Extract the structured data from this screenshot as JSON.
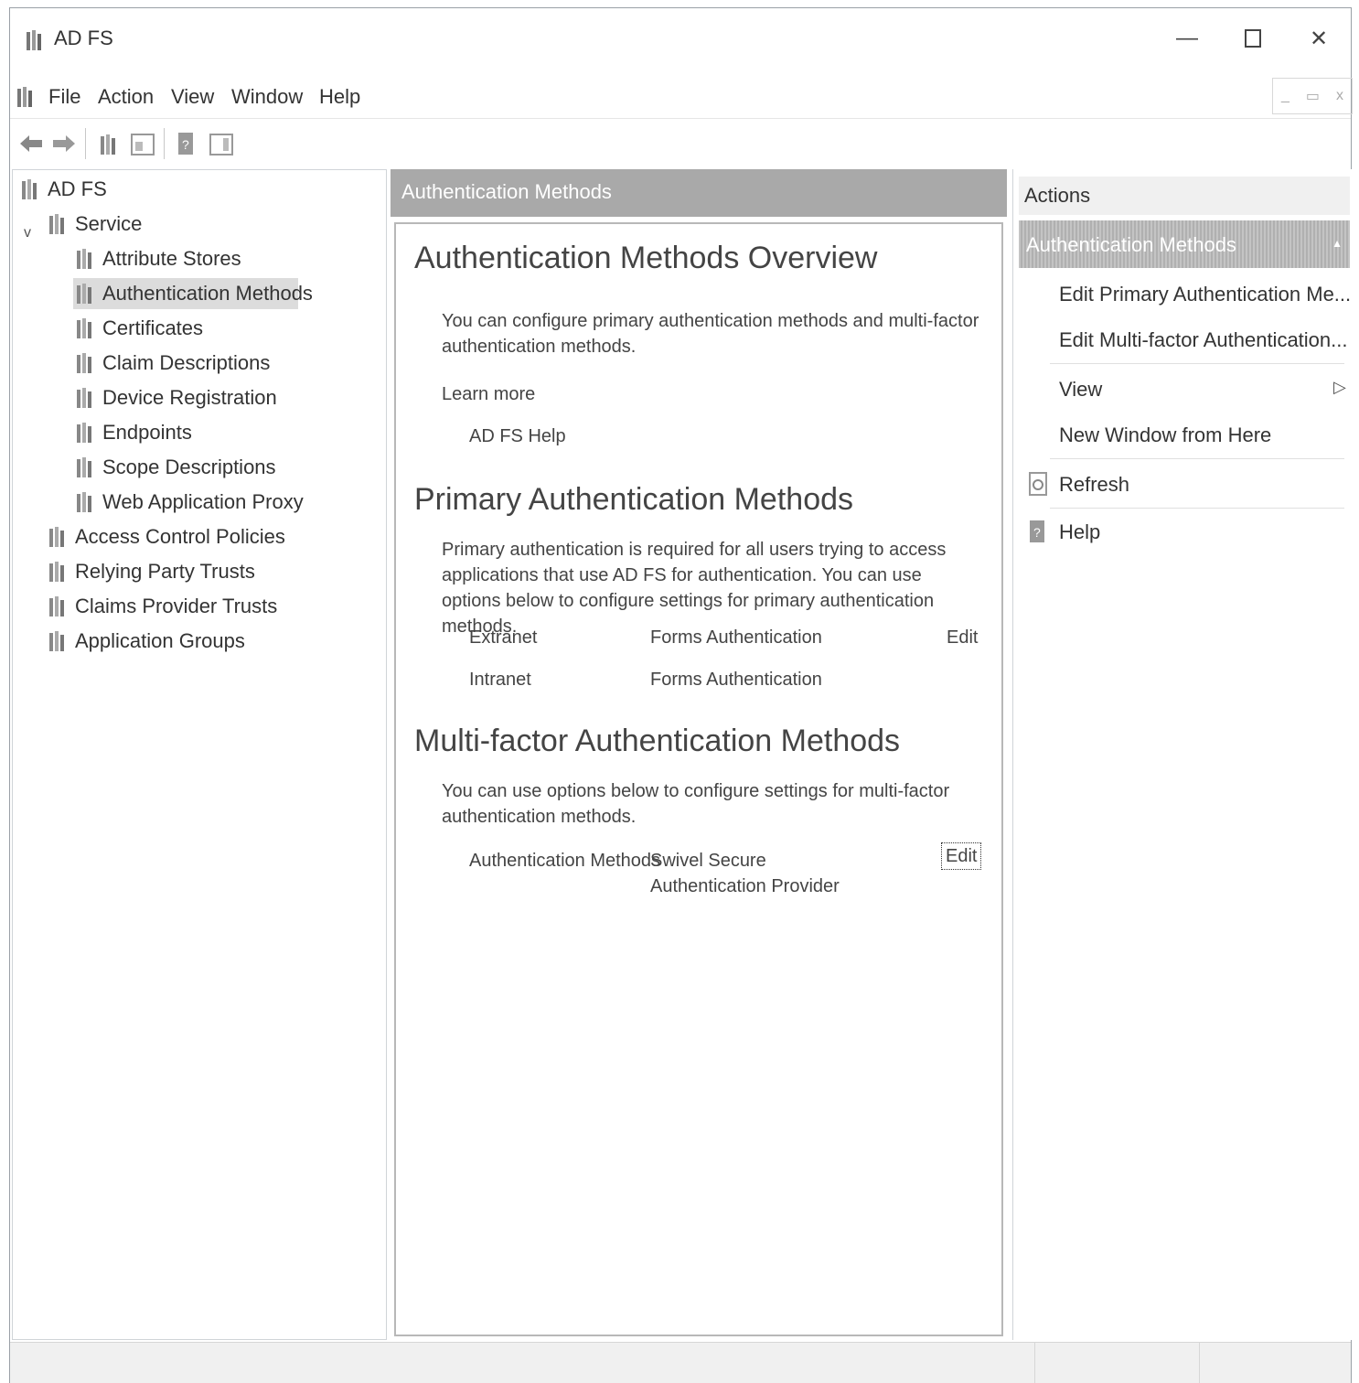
{
  "window": {
    "title": "AD FS",
    "controls": {
      "minimize": "—",
      "close": "✕"
    }
  },
  "menu": {
    "items": [
      "File",
      "Action",
      "View",
      "Window",
      "Help"
    ],
    "mdi": {
      "minimize": "_",
      "restore": "▭",
      "close": "x"
    }
  },
  "toolbar": {
    "icons": [
      "back-arrow-icon",
      "forward-arrow-icon",
      "show-tree-icon",
      "properties-icon",
      "help-icon",
      "action-pane-icon"
    ]
  },
  "tree": {
    "root": "AD FS",
    "service": "Service",
    "service_children": [
      "Attribute Stores",
      "Authentication Methods",
      "Certificates",
      "Claim Descriptions",
      "Device Registration",
      "Endpoints",
      "Scope Descriptions",
      "Web Application Proxy"
    ],
    "other": [
      "Access Control Policies",
      "Relying Party Trusts",
      "Claims Provider Trusts",
      "Application Groups"
    ],
    "selected": "Authentication Methods"
  },
  "main": {
    "header": "Authentication Methods",
    "overview": {
      "title": "Authentication Methods Overview",
      "text": "You can configure primary authentication methods and multi-factor authentication methods.",
      "learn_more": "Learn more",
      "help_link": "AD FS Help"
    },
    "primary": {
      "title": "Primary Authentication Methods",
      "text": "Primary authentication is required for all users trying to access applications that use AD FS for authentication. You can use options below to configure settings for primary authentication methods.",
      "rows": [
        {
          "label": "Extranet",
          "value": "Forms Authentication",
          "edit": "Edit"
        },
        {
          "label": "Intranet",
          "value": "Forms Authentication",
          "edit": ""
        }
      ]
    },
    "mfa": {
      "title": "Multi-factor Authentication Methods",
      "text": "You can use options below to configure settings for multi-factor authentication methods.",
      "row": {
        "label": "Authentication Methods",
        "value": "Swivel Secure Authentication Provider",
        "edit": "Edit"
      }
    }
  },
  "actions": {
    "header": "Actions",
    "section": "Authentication Methods",
    "section_collapse": "▲",
    "items": {
      "edit_primary": "Edit Primary Authentication Me...",
      "edit_mfa": "Edit Multi-factor Authentication...",
      "view": "View",
      "view_arrow": "▷",
      "new_window": "New Window from Here",
      "refresh": "Refresh",
      "help": "Help"
    }
  }
}
